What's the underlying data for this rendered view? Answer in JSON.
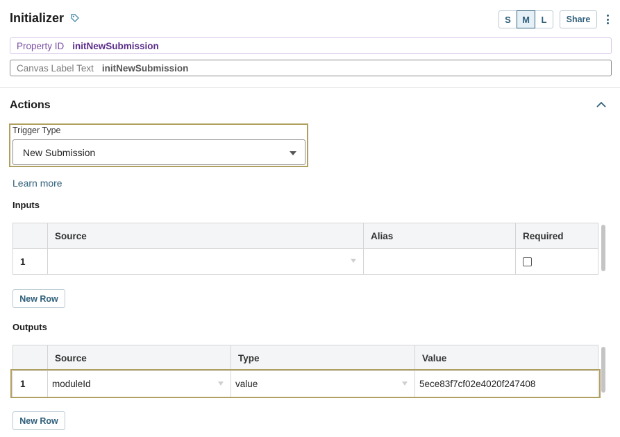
{
  "header": {
    "title": "Initializer",
    "sizes": [
      "S",
      "M",
      "L"
    ],
    "active_size": "M",
    "share_label": "Share"
  },
  "property_id": {
    "label": "Property ID",
    "value": "initNewSubmission"
  },
  "canvas_label": {
    "label": "Canvas Label Text",
    "value": "initNewSubmission"
  },
  "actions": {
    "title": "Actions",
    "trigger_type": {
      "label": "Trigger Type",
      "value": "New Submission"
    },
    "learn_more": "Learn more",
    "inputs": {
      "title": "Inputs",
      "columns": [
        "Source",
        "Alias",
        "Required"
      ],
      "rows": [
        {
          "num": "1",
          "source": "",
          "alias": "",
          "required": false
        }
      ],
      "new_row_label": "New Row"
    },
    "outputs": {
      "title": "Outputs",
      "columns": [
        "Source",
        "Type",
        "Value"
      ],
      "rows": [
        {
          "num": "1",
          "source": "moduleId",
          "type": "value",
          "value": "5ece83f7cf02e4020f247408"
        }
      ],
      "new_row_label": "New Row"
    }
  },
  "colors": {
    "accent": "#2f5f7a",
    "highlight_border": "#b0a060",
    "property_purple": "#5b2d8a"
  }
}
